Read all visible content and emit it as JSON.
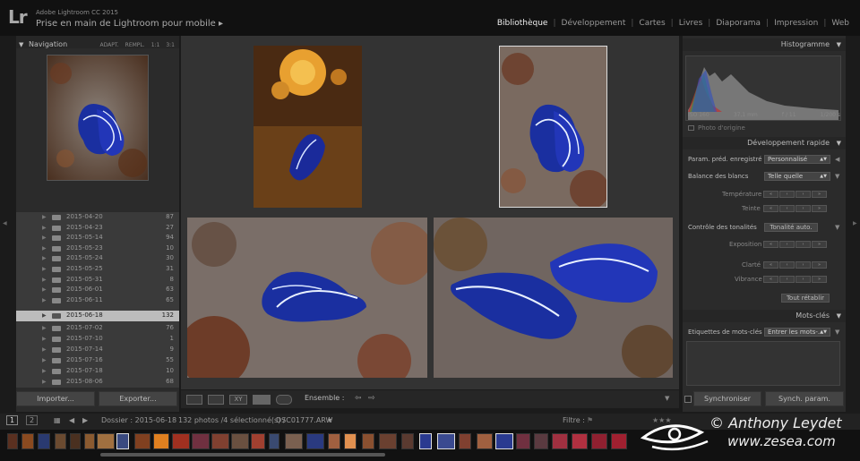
{
  "app": {
    "logo": "Lr",
    "name": "Adobe Lightroom CC 2015",
    "catalog": "Prise en main de Lightroom pour mobile  ▸"
  },
  "modules": [
    {
      "label": "Bibliothèque",
      "active": true
    },
    {
      "label": "Développement"
    },
    {
      "label": "Cartes"
    },
    {
      "label": "Livres"
    },
    {
      "label": "Diaporama"
    },
    {
      "label": "Impression"
    },
    {
      "label": "Web"
    }
  ],
  "navigator": {
    "title": "Navigation",
    "zoom": [
      "ADAPT.",
      "REMPL.",
      "1:1",
      "3:1"
    ]
  },
  "folders": [
    {
      "name": "2015-04-20",
      "count": "87"
    },
    {
      "name": "2015-04-23",
      "count": "27"
    },
    {
      "name": "2015-05-14",
      "count": "94"
    },
    {
      "name": "2015-05-23",
      "count": "10"
    },
    {
      "name": "2015-05-24",
      "count": "30"
    },
    {
      "name": "2015-05-25",
      "count": "31"
    },
    {
      "name": "2015-05-31",
      "count": "8"
    },
    {
      "name": "2015-06-01",
      "count": "63"
    },
    {
      "name": "2015-06-11",
      "count": "65"
    },
    {
      "name": "2015-06-18",
      "count": "132",
      "selected": true
    },
    {
      "name": "2015-07-02",
      "count": "76"
    },
    {
      "name": "2015-07-10",
      "count": "1"
    },
    {
      "name": "2015-07-14",
      "count": "9"
    },
    {
      "name": "2015-07-16",
      "count": "55"
    },
    {
      "name": "2015-07-18",
      "count": "10"
    },
    {
      "name": "2015-08-06",
      "count": "68"
    }
  ],
  "left_buttons": {
    "import": "Importer...",
    "export": "Exporter..."
  },
  "toolbar": {
    "ensemble": "Ensemble :",
    "xy": "XY"
  },
  "histogram": {
    "title": "Histogramme",
    "iso": "ISO 160",
    "focal": "37,1 mm",
    "aperture": "f / 11",
    "shutter": "1/200 s",
    "original": "Photo d'origine"
  },
  "quick_dev": {
    "title": "Développement rapide",
    "preset_label": "Param. préd. enregistré",
    "preset_value": "Personnalisé",
    "wb_label": "Balance des blancs",
    "wb_value": "Telle quelle",
    "temperature": "Température",
    "tint": "Teinte",
    "tone_label": "Contrôle des tonalités",
    "auto_tone": "Tonalité auto.",
    "exposure": "Exposition",
    "clarity": "Clarté",
    "vibrance": "Vibrance",
    "reset": "Tout rétablir"
  },
  "keywords": {
    "title": "Mots-clés",
    "label": "Etiquettes de mots-clés",
    "value": "Entrer les mots-..."
  },
  "right_buttons": {
    "sync": "Synchroniser",
    "sync_params": "Synch. param."
  },
  "filmstrip_header": {
    "view1": "1",
    "view2": "2",
    "source": "Dossier : 2015-06-18",
    "count": "132 photos /4 sélectionné(s) /",
    "file": "DSC01777.ARW",
    "filter": "Filtre :"
  },
  "watermark": {
    "line1": "© Anthony Leydet",
    "line2": "www.zesea.com"
  }
}
